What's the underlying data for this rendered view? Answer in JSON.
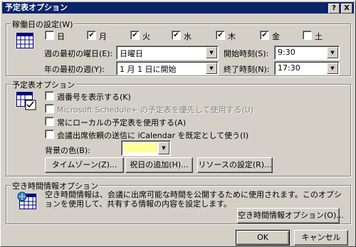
{
  "window": {
    "title": "予定表オプション",
    "help_label": "?",
    "close_label": "X"
  },
  "workweek": {
    "group_title": "稼働日の設定(W)",
    "days": [
      {
        "label": "日",
        "checked": false
      },
      {
        "label": "月",
        "checked": true
      },
      {
        "label": "火",
        "checked": true
      },
      {
        "label": "水",
        "checked": true
      },
      {
        "label": "木",
        "checked": true
      },
      {
        "label": "金",
        "checked": true
      },
      {
        "label": "土",
        "checked": false
      }
    ],
    "first_day_label": "週の最初の曜日(E):",
    "first_day_value": "日曜日",
    "first_week_label": "年の最初の週(Y):",
    "first_week_value": "1 月 1 日に開始",
    "start_time_label": "開始時刻(S):",
    "start_time_value": "9:30",
    "end_time_label": "終了時刻(N):",
    "end_time_value": "17:30"
  },
  "calendar_options": {
    "group_title": "予定表オプション",
    "options": [
      {
        "label": "週番号を表示する(K)",
        "checked": false,
        "disabled": false
      },
      {
        "label": "Microsoft Schedule+ の予定表を優先して使用する(U)",
        "checked": false,
        "disabled": true
      },
      {
        "label": "常にローカルの予定表を使用する(A)",
        "checked": false,
        "disabled": false
      },
      {
        "label": "会議出席依頼の送信に iCalendar を既定として使う(I)",
        "checked": false,
        "disabled": false
      }
    ],
    "background_label": "背景の色(B):",
    "background_color": "#ffff99",
    "timezone_button": "タイムゾーン(Z)...",
    "holidays_button": "祝日の追加(H)...",
    "resources_button": "リソースの設定(R)..."
  },
  "freebusy": {
    "group_title": "空き時間情報オプション",
    "description": "空き時間情報は、会議に出席可能な時間を公開するために使用されます。このオプションを使用して、共有する情報の内容を設定します。",
    "button": "空き時間情報オプション(O)..."
  },
  "footer": {
    "ok_label": "OK",
    "cancel_label": "キャンセル"
  }
}
